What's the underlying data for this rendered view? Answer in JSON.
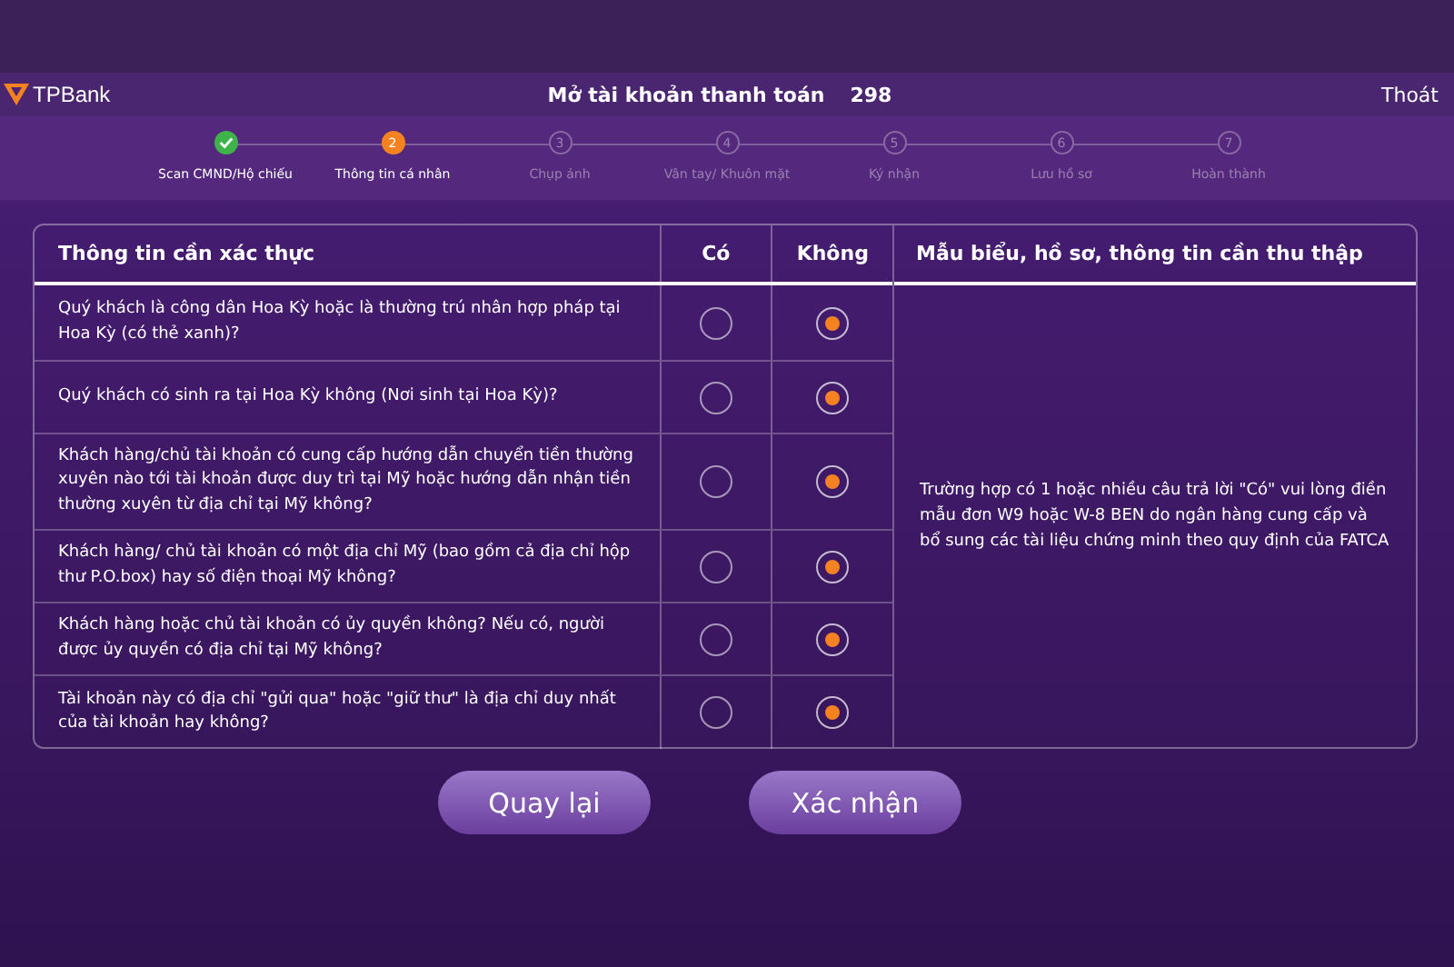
{
  "header": {
    "brand": "TPBank",
    "title": "Mở tài khoản thanh toán",
    "counter": "298",
    "exit": "Thoát"
  },
  "steps": [
    {
      "label": "Scan CMND/Hộ chiếu",
      "done": true,
      "selected": false
    },
    {
      "label": "Thông tin cá nhân",
      "number": "2",
      "done": false,
      "selected": true
    },
    {
      "label": "Chụp ảnh",
      "number": "3",
      "done": false,
      "selected": false
    },
    {
      "label": "Vân tay/ Khuôn mặt",
      "number": "4",
      "done": false,
      "selected": false
    },
    {
      "label": "Ký nhận",
      "number": "5",
      "done": false,
      "selected": false
    },
    {
      "label": "Lưu hồ sơ",
      "number": "6",
      "done": false,
      "selected": false
    },
    {
      "label": "Hoàn thành",
      "number": "7",
      "done": false,
      "selected": false
    }
  ],
  "table": {
    "columns": [
      "Thông tin cần xác thực",
      "Có",
      "Không",
      "Mẫu biểu, hồ sơ, thông tin cần thu thập"
    ],
    "rows": [
      {
        "question": "Quý khách là công dân Hoa Kỳ hoặc là thường trú nhân hợp pháp tại Hoa Kỳ (có thẻ xanh)?",
        "options": [
          {
            "selected": false
          },
          {
            "selected": true
          }
        ]
      },
      {
        "question": "Quý khách có sinh ra tại Hoa Kỳ không (Nơi sinh tại Hoa Kỳ)?",
        "options": [
          {
            "selected": false
          },
          {
            "selected": true
          }
        ]
      },
      {
        "question": "Khách hàng/chủ tài khoản có cung cấp hướng dẫn chuyển tiền thường xuyên nào tới tài khoản được duy trì tại Mỹ hoặc hướng dẫn nhận tiền thường xuyên từ địa chỉ tại Mỹ không?",
        "options": [
          {
            "selected": false
          },
          {
            "selected": true
          }
        ]
      },
      {
        "question": "Khách hàng/ chủ tài khoản có một địa chỉ Mỹ (bao gồm cả địa chỉ hộp thư P.O.box) hay số điện thoại Mỹ không?",
        "options": [
          {
            "selected": false
          },
          {
            "selected": true
          }
        ]
      },
      {
        "question": "Khách hàng hoặc chủ tài khoản có ủy quyền không? Nếu có, người được ủy quyền có địa chỉ tại Mỹ không?",
        "options": [
          {
            "selected": false
          },
          {
            "selected": true
          }
        ]
      },
      {
        "question": "Tài khoản này có địa chỉ \"gửi qua\" hoặc \"giữ thư\" là địa chỉ duy nhất của tài khoản hay không?",
        "options": [
          {
            "selected": false
          },
          {
            "selected": true
          }
        ]
      }
    ],
    "note": "Trường hợp có 1 hoặc nhiều câu trả lời \"Có\" vui lòng điền mẫu đơn W9 hoặc W-8 BEN do ngân hàng cung cấp và bổ sung các tài liệu chứng minh theo quy định của FATCA"
  },
  "buttons": [
    "Quay lại",
    "Xác nhận"
  ]
}
